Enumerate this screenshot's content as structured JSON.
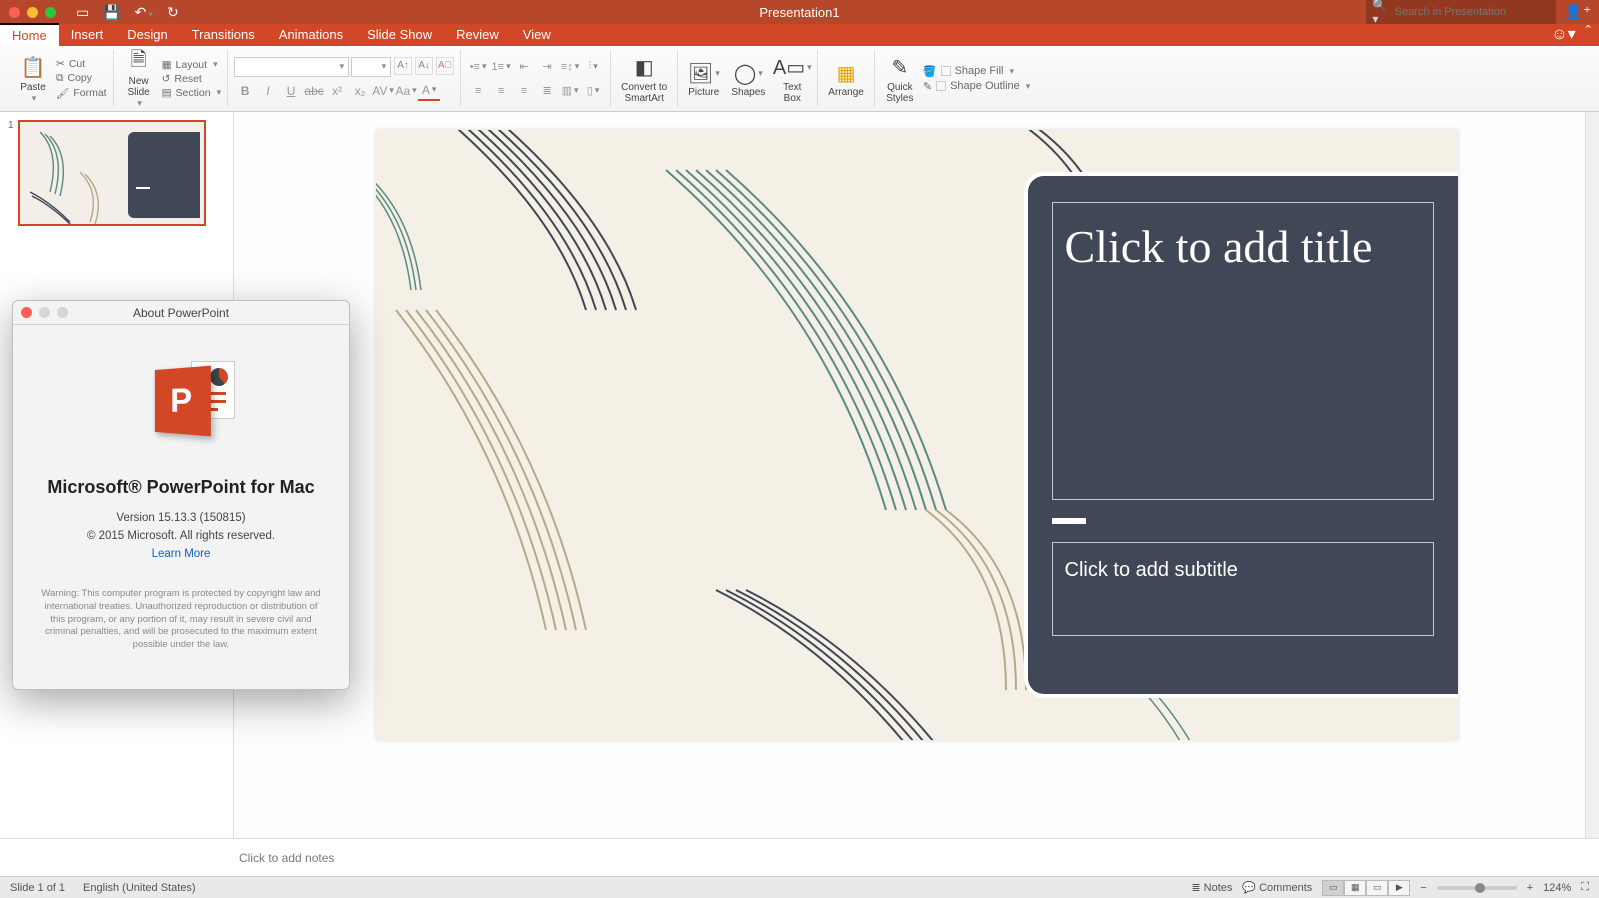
{
  "window": {
    "title": "Presentation1"
  },
  "search": {
    "placeholder": "Search in Presentation"
  },
  "tabs": [
    "Home",
    "Insert",
    "Design",
    "Transitions",
    "Animations",
    "Slide Show",
    "Review",
    "View"
  ],
  "active_tab": "Home",
  "ribbon": {
    "paste": "Paste",
    "cut": "Cut",
    "copy": "Copy",
    "format": "Format",
    "new_slide": "New\nSlide",
    "layout": "Layout",
    "reset": "Reset",
    "section": "Section",
    "convert": "Convert to\nSmartArt",
    "picture": "Picture",
    "shapes": "Shapes",
    "textbox": "Text\nBox",
    "arrange": "Arrange",
    "quick_styles": "Quick\nStyles",
    "shape_fill": "Shape Fill",
    "shape_outline": "Shape Outline"
  },
  "slide": {
    "title_placeholder": "Click to add title",
    "subtitle_placeholder": "Click to add subtitle"
  },
  "thumb": {
    "number": "1"
  },
  "notes": {
    "placeholder": "Click to add notes"
  },
  "status": {
    "slide": "Slide 1 of 1",
    "lang": "English (United States)",
    "notes": "Notes",
    "comments": "Comments",
    "zoom": "124%"
  },
  "about": {
    "title": "About PowerPoint",
    "product": "Microsoft® PowerPoint for Mac",
    "version": "Version 15.13.3 (150815)",
    "copyright": "© 2015 Microsoft. All rights reserved.",
    "learn_more": "Learn More",
    "warning": "Warning: This computer program is protected by copyright law and international treaties. Unauthorized reproduction or distribution of this program, or any portion of it, may result in severe civil and criminal penalties, and will be prosecuted to the maximum extent possible under the law."
  },
  "colors": {
    "brand": "#d24726",
    "panel": "#404756"
  }
}
